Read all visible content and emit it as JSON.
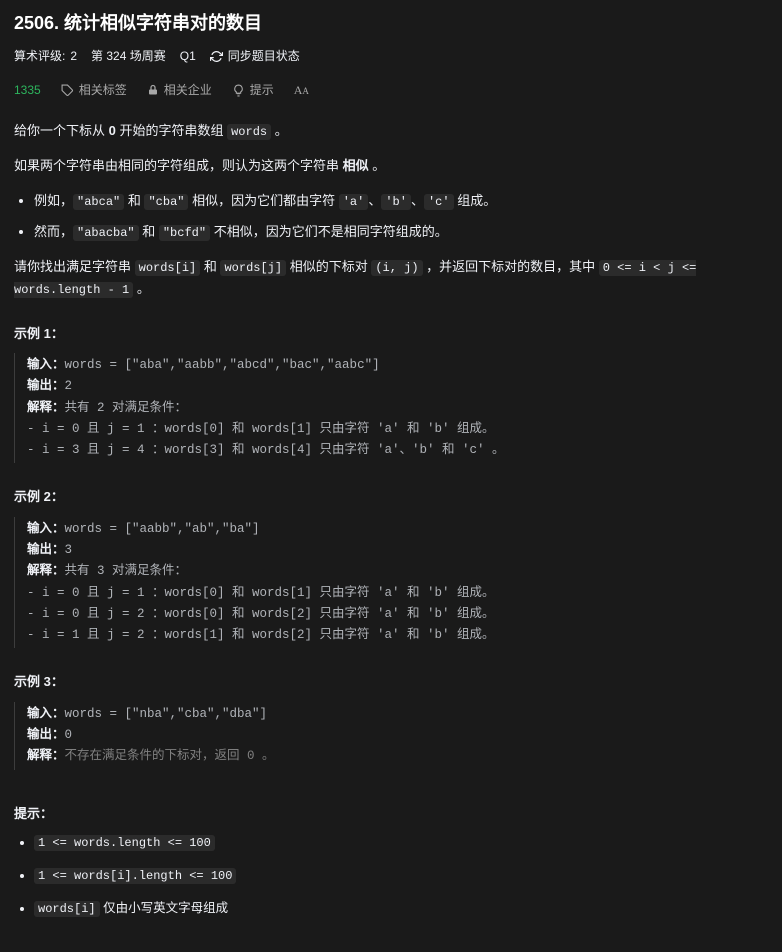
{
  "title": "2506. 统计相似字符串对的数目",
  "meta": {
    "rating_label": "算术评级:",
    "rating_value": "2",
    "contest": "第 324 场周赛",
    "q": "Q1",
    "sync": "同步题目状态"
  },
  "toolbar": {
    "count": "1335",
    "tags": "相关标签",
    "companies": "相关企业",
    "hint": "提示"
  },
  "desc": {
    "p1_a": "给你一个下标从 ",
    "p1_b": "0",
    "p1_c": " 开始的字符串数组 ",
    "p1_code": "words",
    "p1_d": " 。",
    "p2_a": "如果两个字符串由相同的字符组成，则认为这两个字符串 ",
    "p2_b": "相似",
    "p2_c": " 。",
    "b1_a": "例如，",
    "b1_c1": "\"abca\"",
    "b1_mid": " 和 ",
    "b1_c2": "\"cba\"",
    "b1_b": " 相似，因为它们都由字符 ",
    "b1_c3": "'a'",
    "b1_s1": "、",
    "b1_c4": "'b'",
    "b1_s2": "、",
    "b1_c5": "'c'",
    "b1_end": " 组成。",
    "b2_a": "然而，",
    "b2_c1": "\"abacba\"",
    "b2_mid": " 和 ",
    "b2_c2": "\"bcfd\"",
    "b2_b": " 不相似，因为它们不是相同字符组成的。",
    "p3_a": "请你找出满足字符串 ",
    "p3_c1": "words[i]",
    "p3_mid": " 和 ",
    "p3_c2": "words[j]",
    "p3_b": " 相似的下标对 ",
    "p3_c3": "(i, j)",
    "p3_c": " ，并返回下标对的数目，其中 ",
    "p3_c4": "0 <= i < j <= words.length - 1",
    "p3_d": " 。"
  },
  "ex1_label": "示例 1：",
  "ex1": "<span class=\"k\">输入：</span>words = [\"aba\",\"aabb\",\"abcd\",\"bac\",\"aabc\"]\n<span class=\"k\">输出：</span>2\n<span class=\"k\">解释：</span>共有 2 对满足条件：\n- i = 0 且 j = 1 ：words[0] 和 words[1] 只由字符 'a' 和 'b' 组成。\n- i = 3 且 j = 4 ：words[3] 和 words[4] 只由字符 'a'、'b' 和 'c' 。",
  "ex2_label": "示例 2：",
  "ex2": "<span class=\"k\">输入：</span>words = [\"aabb\",\"ab\",\"ba\"]\n<span class=\"k\">输出：</span>3\n<span class=\"k\">解释：</span>共有 3 对满足条件：\n- i = 0 且 j = 1 ：words[0] 和 words[1] 只由字符 'a' 和 'b' 组成。\n- i = 0 且 j = 2 ：words[0] 和 words[2] 只由字符 'a' 和 'b' 组成。\n- i = 1 且 j = 2 ：words[1] 和 words[2] 只由字符 'a' 和 'b' 组成。",
  "ex3_label": "示例 3：",
  "ex3": "<span class=\"k\">输入：</span>words = [\"nba\",\"cba\",\"dba\"]\n<span class=\"k\">输出：</span>0\n<span class=\"k\">解释：</span><span class=\"dim\">不存在满足条件的下标对，返回 0 。</span>",
  "hints_label": "提示：",
  "constraints": {
    "c1": "1 <= words.length <= 100",
    "c2": "1 <= words[i].length <= 100",
    "c3_code": "words[i]",
    "c3_text": " 仅由小写英文字母组成"
  }
}
